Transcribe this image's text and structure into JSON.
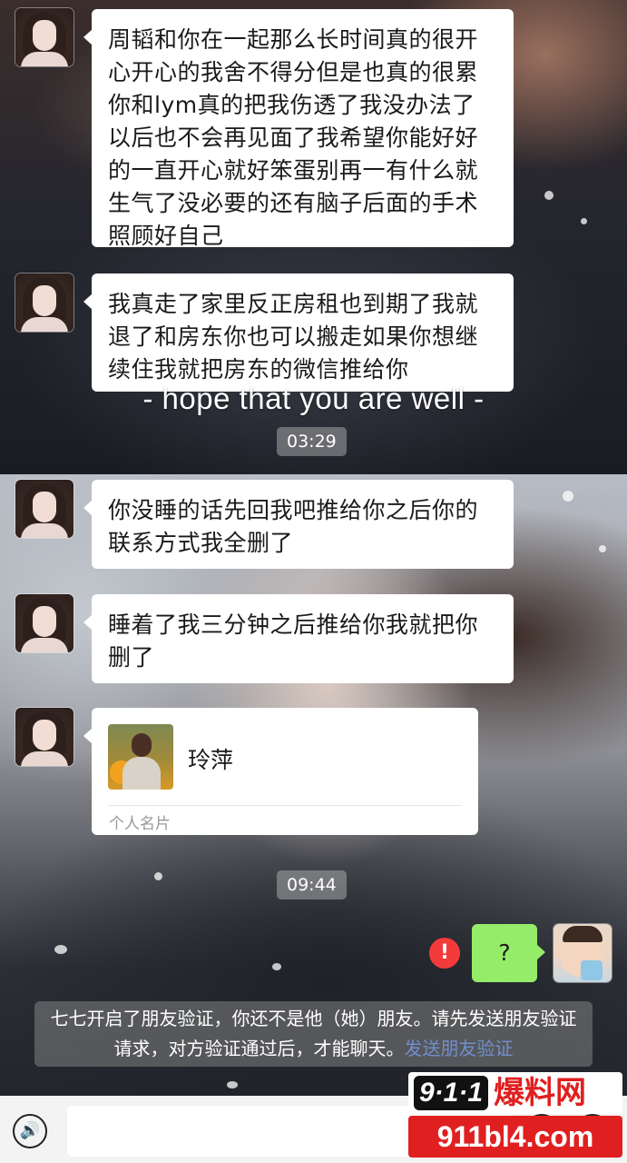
{
  "caption": "- hope that you are well -",
  "timestamps": [
    "03:29",
    "09:44"
  ],
  "messages": [
    "周韬和你在一起那么长时间真的很开心开心的我舍不得分但是也真的很累你和lym真的把我伤透了我没办法了以后也不会再见面了我希望你能好好的一直开心就好笨蛋别再一有什么就生气了没必要的还有脑子后面的手术照顾好自己",
    "我真走了家里反正房租也到期了我就退了和房东你也可以搬走如果你想继续住我就把房东的微信推给你",
    "你没睡的话先回我吧推给你之后你的联系方式我全删了",
    "睡着了我三分钟之后推给你我就把你删了"
  ],
  "card": {
    "name": "玲萍",
    "type": "个人名片"
  },
  "my_message": "?",
  "error_mark": "!",
  "notice": {
    "text": "七七开启了朋友验证，你还不是他（她）朋友。请先发送朋友验证请求，对方验证通过后，才能聊天。",
    "link": "发送朋友验证"
  },
  "watermark": {
    "number": "9·1·1",
    "label": "爆料网",
    "url": "911bl4.com"
  },
  "colors": {
    "sent_bubble": "#95ec69",
    "received_bubble": "#ffffff",
    "error": "#f43b3b",
    "link": "#6f8fce",
    "watermark_red": "#e02020"
  },
  "icons": {
    "voice": "voice-icon",
    "emoji": "emoji-icon",
    "plus": "plus-icon"
  }
}
